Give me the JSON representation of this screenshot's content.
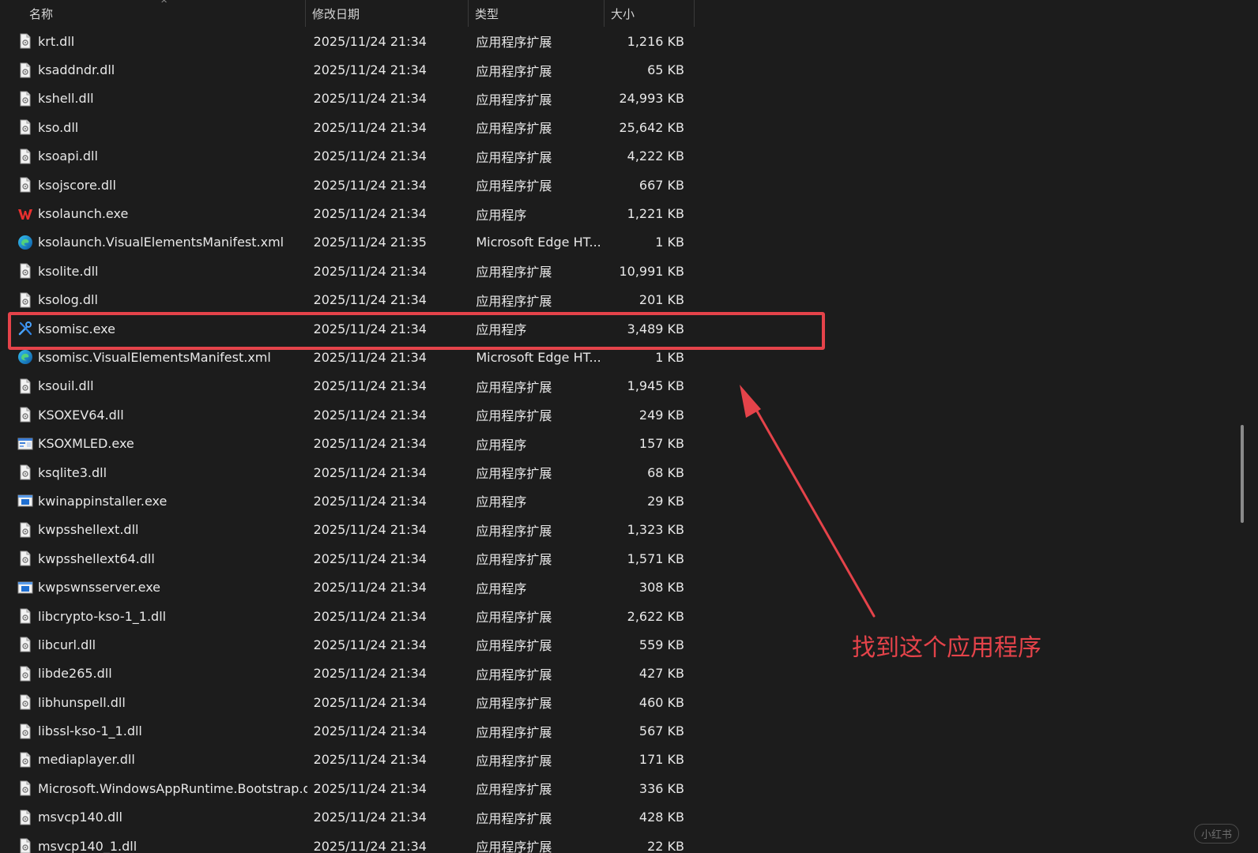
{
  "header": {
    "name": "名称",
    "date": "修改日期",
    "type": "类型",
    "size": "大小",
    "sort_caret": "^"
  },
  "rows": [
    {
      "icon": "dll-file-icon",
      "name": "krt.dll",
      "date": "2025/11/24 21:34",
      "type": "应用程序扩展",
      "size": "1,216 KB"
    },
    {
      "icon": "dll-file-icon",
      "name": "ksaddndr.dll",
      "date": "2025/11/24 21:34",
      "type": "应用程序扩展",
      "size": "65 KB"
    },
    {
      "icon": "dll-file-icon",
      "name": "kshell.dll",
      "date": "2025/11/24 21:34",
      "type": "应用程序扩展",
      "size": "24,993 KB"
    },
    {
      "icon": "dll-file-icon",
      "name": "kso.dll",
      "date": "2025/11/24 21:34",
      "type": "应用程序扩展",
      "size": "25,642 KB"
    },
    {
      "icon": "dll-file-icon",
      "name": "ksoapi.dll",
      "date": "2025/11/24 21:34",
      "type": "应用程序扩展",
      "size": "4,222 KB"
    },
    {
      "icon": "dll-file-icon",
      "name": "ksojscore.dll",
      "date": "2025/11/24 21:34",
      "type": "应用程序扩展",
      "size": "667 KB"
    },
    {
      "icon": "wps-logo-icon",
      "name": "ksolaunch.exe",
      "date": "2025/11/24 21:34",
      "type": "应用程序",
      "size": "1,221 KB"
    },
    {
      "icon": "edge-icon",
      "name": "ksolaunch.VisualElementsManifest.xml",
      "date": "2025/11/24 21:35",
      "type": "Microsoft Edge HT...",
      "size": "1 KB"
    },
    {
      "icon": "dll-file-icon",
      "name": "ksolite.dll",
      "date": "2025/11/24 21:34",
      "type": "应用程序扩展",
      "size": "10,991 KB"
    },
    {
      "icon": "dll-file-icon",
      "name": "ksolog.dll",
      "date": "2025/11/24 21:34",
      "type": "应用程序扩展",
      "size": "201 KB"
    },
    {
      "icon": "tools-icon",
      "name": "ksomisc.exe",
      "date": "2025/11/24 21:34",
      "type": "应用程序",
      "size": "3,489 KB"
    },
    {
      "icon": "edge-icon",
      "name": "ksomisc.VisualElementsManifest.xml",
      "date": "2025/11/24 21:34",
      "type": "Microsoft Edge HT...",
      "size": "1 KB"
    },
    {
      "icon": "dll-file-icon",
      "name": "ksouil.dll",
      "date": "2025/11/24 21:34",
      "type": "应用程序扩展",
      "size": "1,945 KB"
    },
    {
      "icon": "dll-file-icon",
      "name": "KSOXEV64.dll",
      "date": "2025/11/24 21:34",
      "type": "应用程序扩展",
      "size": "249 KB"
    },
    {
      "icon": "xml-editor-icon",
      "name": "KSOXMLED.exe",
      "date": "2025/11/24 21:34",
      "type": "应用程序",
      "size": "157 KB"
    },
    {
      "icon": "dll-file-icon",
      "name": "ksqlite3.dll",
      "date": "2025/11/24 21:34",
      "type": "应用程序扩展",
      "size": "68 KB"
    },
    {
      "icon": "app-window-icon",
      "name": "kwinappinstaller.exe",
      "date": "2025/11/24 21:34",
      "type": "应用程序",
      "size": "29 KB"
    },
    {
      "icon": "dll-file-icon",
      "name": "kwpsshellext.dll",
      "date": "2025/11/24 21:34",
      "type": "应用程序扩展",
      "size": "1,323 KB"
    },
    {
      "icon": "dll-file-icon",
      "name": "kwpsshellext64.dll",
      "date": "2025/11/24 21:34",
      "type": "应用程序扩展",
      "size": "1,571 KB"
    },
    {
      "icon": "app-window-icon",
      "name": "kwpswnsserver.exe",
      "date": "2025/11/24 21:34",
      "type": "应用程序",
      "size": "308 KB"
    },
    {
      "icon": "dll-file-icon",
      "name": "libcrypto-kso-1_1.dll",
      "date": "2025/11/24 21:34",
      "type": "应用程序扩展",
      "size": "2,622 KB"
    },
    {
      "icon": "dll-file-icon",
      "name": "libcurl.dll",
      "date": "2025/11/24 21:34",
      "type": "应用程序扩展",
      "size": "559 KB"
    },
    {
      "icon": "dll-file-icon",
      "name": "libde265.dll",
      "date": "2025/11/24 21:34",
      "type": "应用程序扩展",
      "size": "427 KB"
    },
    {
      "icon": "dll-file-icon",
      "name": "libhunspell.dll",
      "date": "2025/11/24 21:34",
      "type": "应用程序扩展",
      "size": "460 KB"
    },
    {
      "icon": "dll-file-icon",
      "name": "libssl-kso-1_1.dll",
      "date": "2025/11/24 21:34",
      "type": "应用程序扩展",
      "size": "567 KB"
    },
    {
      "icon": "dll-file-icon",
      "name": "mediaplayer.dll",
      "date": "2025/11/24 21:34",
      "type": "应用程序扩展",
      "size": "171 KB"
    },
    {
      "icon": "dll-file-icon",
      "name": "Microsoft.WindowsAppRuntime.Bootstrap.dll",
      "date": "2025/11/24 21:34",
      "type": "应用程序扩展",
      "size": "336 KB"
    },
    {
      "icon": "dll-file-icon",
      "name": "msvcp140.dll",
      "date": "2025/11/24 21:34",
      "type": "应用程序扩展",
      "size": "428 KB"
    },
    {
      "icon": "dll-file-icon",
      "name": "msvcp140_1.dll",
      "date": "2025/11/24 21:34",
      "type": "应用程序扩展",
      "size": "22 KB"
    }
  ],
  "annotation": {
    "text": "找到这个应用程序",
    "color": "#e5434a"
  },
  "watermark": "小红书",
  "colors": {
    "background": "#1c1c1c",
    "text": "#e8e8e8",
    "highlight": "#e5434a"
  }
}
